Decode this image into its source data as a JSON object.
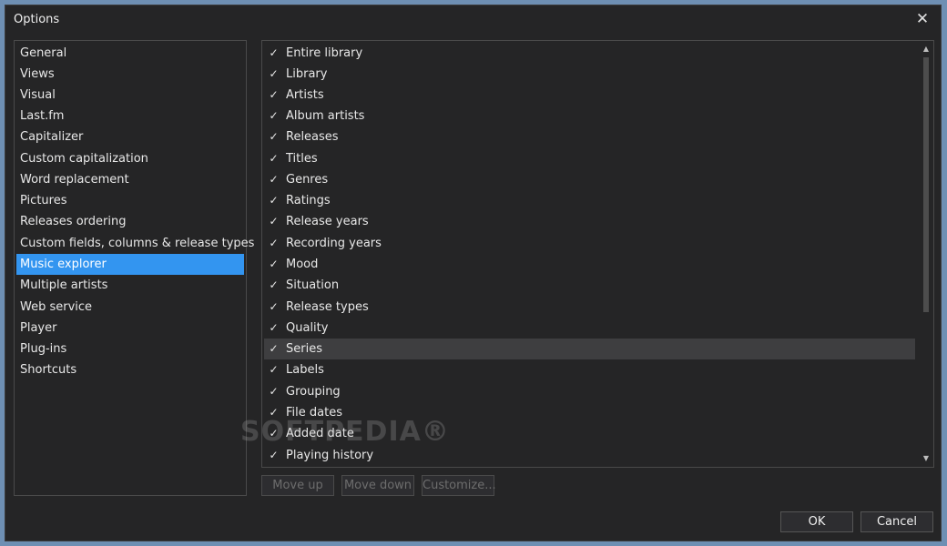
{
  "window": {
    "title": "Options"
  },
  "sidebar": {
    "items": [
      {
        "label": "General"
      },
      {
        "label": "Views"
      },
      {
        "label": "Visual"
      },
      {
        "label": "Last.fm"
      },
      {
        "label": "Capitalizer"
      },
      {
        "label": "Custom capitalization"
      },
      {
        "label": "Word replacement"
      },
      {
        "label": "Pictures"
      },
      {
        "label": "Releases ordering"
      },
      {
        "label": "Custom fields, columns & release types"
      },
      {
        "label": "Music explorer",
        "selected": true
      },
      {
        "label": "Multiple artists"
      },
      {
        "label": "Web service"
      },
      {
        "label": "Player"
      },
      {
        "label": "Plug-ins"
      },
      {
        "label": "Shortcuts"
      }
    ]
  },
  "explorer_list": {
    "check_glyph": "✓",
    "items": [
      {
        "label": "Entire library",
        "checked": true
      },
      {
        "label": "Library",
        "checked": true
      },
      {
        "label": "Artists",
        "checked": true
      },
      {
        "label": "Album artists",
        "checked": true
      },
      {
        "label": "Releases",
        "checked": true
      },
      {
        "label": "Titles",
        "checked": true
      },
      {
        "label": "Genres",
        "checked": true
      },
      {
        "label": "Ratings",
        "checked": true
      },
      {
        "label": "Release years",
        "checked": true
      },
      {
        "label": "Recording years",
        "checked": true
      },
      {
        "label": "Mood",
        "checked": true
      },
      {
        "label": "Situation",
        "checked": true
      },
      {
        "label": "Release types",
        "checked": true
      },
      {
        "label": "Quality",
        "checked": true
      },
      {
        "label": "Series",
        "checked": true,
        "hover": true
      },
      {
        "label": "Labels",
        "checked": true
      },
      {
        "label": "Grouping",
        "checked": true
      },
      {
        "label": "File dates",
        "checked": true
      },
      {
        "label": "Added date",
        "checked": true
      },
      {
        "label": "Playing history",
        "checked": true
      }
    ]
  },
  "list_buttons": {
    "move_up": "Move up",
    "move_down": "Move down",
    "customize": "Customize..."
  },
  "footer": {
    "ok": "OK",
    "cancel": "Cancel"
  },
  "watermark": "SOFTPEDIA®",
  "colors": {
    "selection": "#3395f0",
    "hover_row": "#3e3e40",
    "background": "#252526"
  }
}
